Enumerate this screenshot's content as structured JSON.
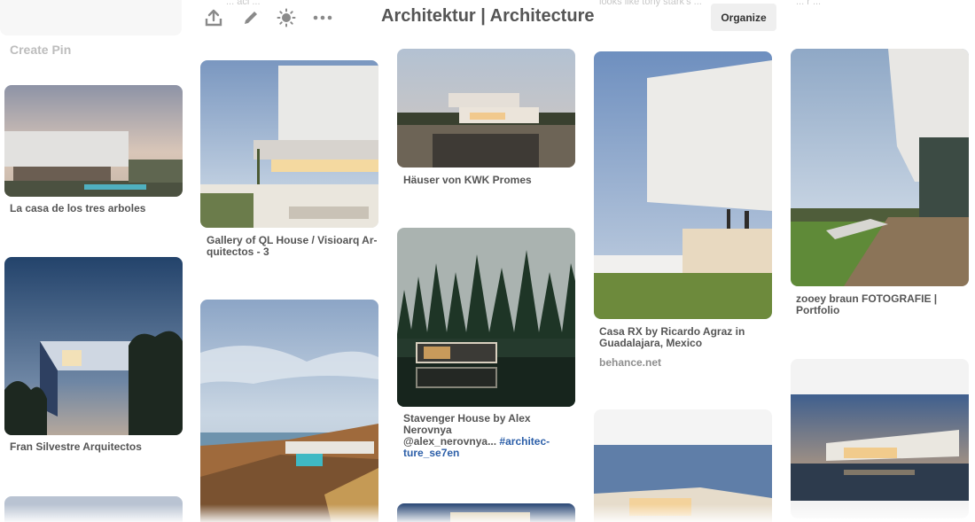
{
  "board": {
    "title": "Architektur | Architecture",
    "organize_label": "Organize",
    "create_pin_label": "Create Pin"
  },
  "toolbar_icons": [
    "upload-icon",
    "edit-icon",
    "brightness-icon",
    "more-icon"
  ],
  "ghost_text": {
    "left": "... aci ...",
    "middle": "looks like tony stark's ...",
    "right": "... r ..."
  },
  "pins": [
    {
      "title": "La casa de los tres arboles"
    },
    {
      "title": "Fran Silvestre Arquitectos"
    },
    {
      "title_line1": "Gallery of QL House / Visioarq Ar-",
      "title_line2": "quitectos - 3"
    },
    {
      "title": "Häuser von KWK Promes"
    },
    {
      "title_line1": "Stavenger House by Alex",
      "title_line2": "Nerovnya",
      "title_line3_text": "@alex_nerovnya... ",
      "title_line3_tag": "#architec-",
      "title_line4_tag": "ture_se7en"
    },
    {
      "title_line1": "Casa RX by Ricardo Agraz in",
      "title_line2": "Guadalajara, Mexico",
      "source": "behance.net"
    },
    {
      "title_line1": "zooey braun FOTOGRAFIE |",
      "title_line2": "Portfolio"
    }
  ]
}
